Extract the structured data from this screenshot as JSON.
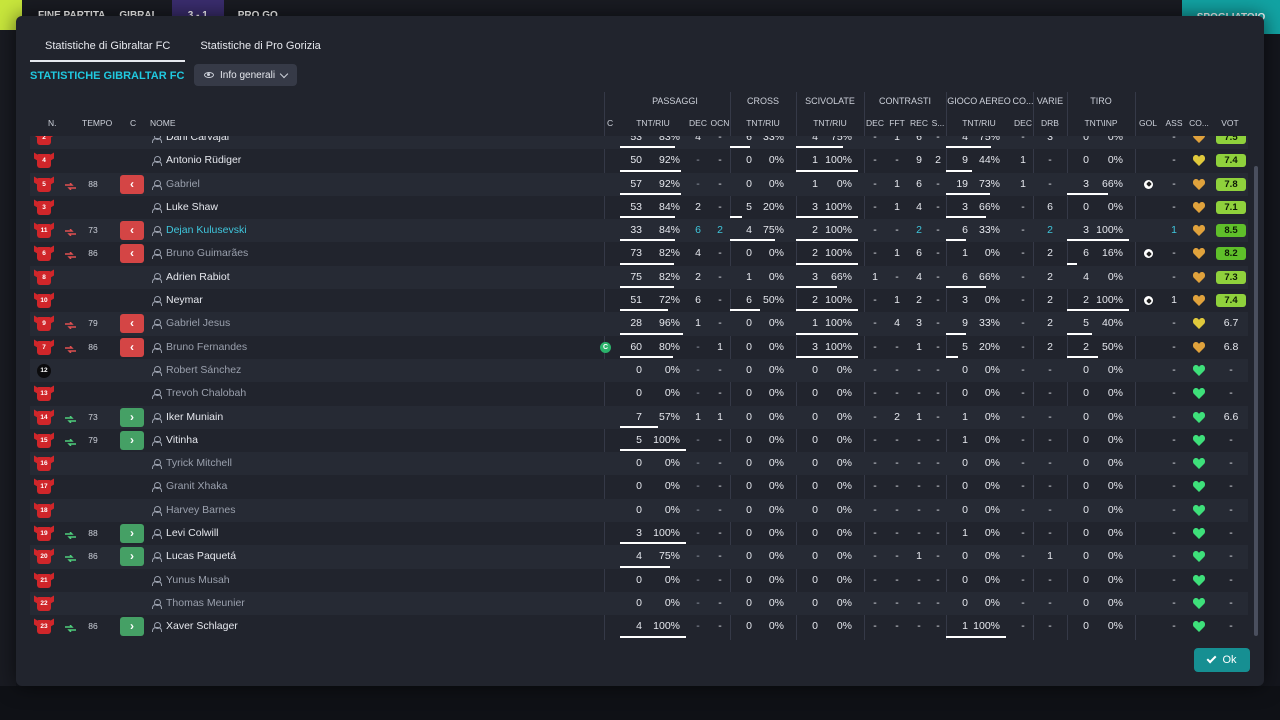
{
  "background": {
    "status": "FINE PARTITA",
    "home_short": "GIBRAL",
    "score": "3 - 1",
    "away_short": "PRO GO",
    "right_button": "SPOGLIATOIO"
  },
  "tabs": [
    {
      "label": "Statistiche di Gibraltar FC",
      "active": true
    },
    {
      "label": "Statistiche di Pro Gorizia",
      "active": false
    }
  ],
  "section_title": "STATISTICHE GIBRALTAR FC",
  "view_select": "Info generali",
  "groups": {
    "passaggi": "PASSAGGI",
    "cross": "CROSS",
    "scivolate": "SCIVOLATE",
    "contrasti": "CONTRASTI",
    "gioco_aereo": "GIOCO AEREO",
    "co": "CO...",
    "varie": "VARIE",
    "tiro": "TIRO"
  },
  "columns": {
    "n": "N.",
    "tempo": "TEMPO",
    "c": "C",
    "nome": "NOME",
    "c2": "C",
    "tnt_riu": "TNT/RIU",
    "dec": "DEC",
    "ocn": "OCN",
    "cross_tnt": "TNT/RIU",
    "sciv_tnt": "TNT/RIU",
    "contr_dec": "DEC",
    "fft": "FFT",
    "rec": "REC",
    "s": "S...",
    "aereo_tnt": "TNT/RIU",
    "co_dec": "DEC",
    "drb": "DRB",
    "tiro_tnt": "TNT\\INP",
    "gol": "GOL",
    "ass": "ASS",
    "co_col": "CO...",
    "vot": "VOT"
  },
  "players": [
    {
      "num": "2",
      "sub": "",
      "min": "",
      "btn": "",
      "name": "Dani Carvajal",
      "style": "",
      "capt": false,
      "pt": "53",
      "pp": "83%",
      "pbar": 0.83,
      "pdec": "4",
      "pocn": "-",
      "ct": "6",
      "cp": "33%",
      "cbar": 0.33,
      "st": "4",
      "sp": "75%",
      "sbar": 0.75,
      "tdec": "-",
      "fft": "1",
      "rec": "6",
      "s": "-",
      "at": "4",
      "ap": "75%",
      "abar": 0.75,
      "codec": "-",
      "drb": "3",
      "tt": "0",
      "tp": "0%",
      "tbar": 0,
      "gol": "",
      "ass": "-",
      "heart": "#e0a23c",
      "vot": "7.5",
      "votbg": "#8fd13c"
    },
    {
      "num": "4",
      "sub": "",
      "min": "",
      "btn": "",
      "name": "Antonio Rüdiger",
      "style": "",
      "capt": false,
      "pt": "50",
      "pp": "92%",
      "pbar": 0.92,
      "pdec": "-",
      "pocn": "-",
      "ct": "0",
      "cp": "0%",
      "cbar": 0,
      "st": "1",
      "sp": "100%",
      "sbar": 1,
      "tdec": "-",
      "fft": "-",
      "rec": "9",
      "s": "2",
      "at": "9",
      "ap": "44%",
      "abar": 0.44,
      "codec": "1",
      "drb": "-",
      "tt": "0",
      "tp": "0%",
      "tbar": 0,
      "gol": "",
      "ass": "-",
      "heart": "#e0c93c",
      "vot": "7.4",
      "votbg": "#8fd13c"
    },
    {
      "num": "5",
      "sub": "out",
      "min": "88",
      "btn": "out",
      "name": "Gabriel",
      "style": "dim",
      "capt": false,
      "pt": "57",
      "pp": "92%",
      "pbar": 0.92,
      "pdec": "-",
      "pocn": "-",
      "ct": "0",
      "cp": "0%",
      "cbar": 0,
      "st": "1",
      "sp": "0%",
      "sbar": 0,
      "tdec": "-",
      "fft": "1",
      "rec": "6",
      "s": "-",
      "at": "19",
      "ap": "73%",
      "abar": 0.73,
      "codec": "1",
      "drb": "-",
      "tt": "3",
      "tp": "66%",
      "tbar": 0.66,
      "gol": "ball",
      "ass": "-",
      "heart": "#e0a23c",
      "vot": "7.8",
      "votbg": "#8fd13c"
    },
    {
      "num": "3",
      "sub": "",
      "min": "",
      "btn": "",
      "name": "Luke Shaw",
      "style": "",
      "capt": false,
      "pt": "53",
      "pp": "84%",
      "pbar": 0.84,
      "pdec": "2",
      "pocn": "-",
      "ct": "5",
      "cp": "20%",
      "cbar": 0.2,
      "st": "3",
      "sp": "100%",
      "sbar": 1,
      "tdec": "-",
      "fft": "1",
      "rec": "4",
      "s": "-",
      "at": "3",
      "ap": "66%",
      "abar": 0.66,
      "codec": "-",
      "drb": "6",
      "tt": "0",
      "tp": "0%",
      "tbar": 0,
      "gol": "",
      "ass": "-",
      "heart": "#e0a23c",
      "vot": "7.1",
      "votbg": "#8fd13c"
    },
    {
      "num": "11",
      "sub": "out",
      "min": "73",
      "btn": "out",
      "name": "Dejan Kulusevski",
      "style": "hl",
      "capt": false,
      "pt": "33",
      "pp": "84%",
      "pbar": 0.84,
      "pdec": "6",
      "pocn": "2",
      "ct": "4",
      "cp": "75%",
      "cbar": 0.75,
      "st": "2",
      "sp": "100%",
      "sbar": 1,
      "tdec": "-",
      "fft": "-",
      "rec": "2",
      "s": "-",
      "at": "6",
      "ap": "33%",
      "abar": 0.33,
      "codec": "-",
      "drb": "2",
      "tt": "3",
      "tp": "100%",
      "tbar": 1,
      "gol": "",
      "ass": "1",
      "heart": "#e0a23c",
      "vot": "8.5",
      "votbg": "#5fbf2a"
    },
    {
      "num": "6",
      "sub": "out",
      "min": "86",
      "btn": "out",
      "name": "Bruno Guimarães",
      "style": "dim",
      "capt": false,
      "pt": "73",
      "pp": "82%",
      "pbar": 0.82,
      "pdec": "4",
      "pocn": "-",
      "ct": "0",
      "cp": "0%",
      "cbar": 0,
      "st": "2",
      "sp": "100%",
      "sbar": 1,
      "tdec": "-",
      "fft": "1",
      "rec": "6",
      "s": "-",
      "at": "1",
      "ap": "0%",
      "abar": 0,
      "codec": "-",
      "drb": "2",
      "tt": "6",
      "tp": "16%",
      "tbar": 0.16,
      "gol": "ball",
      "ass": "-",
      "heart": "#e0a23c",
      "vot": "8.2",
      "votbg": "#5fbf2a"
    },
    {
      "num": "8",
      "sub": "",
      "min": "",
      "btn": "",
      "name": "Adrien Rabiot",
      "style": "",
      "capt": false,
      "pt": "75",
      "pp": "82%",
      "pbar": 0.82,
      "pdec": "2",
      "pocn": "-",
      "ct": "1",
      "cp": "0%",
      "cbar": 0,
      "st": "3",
      "sp": "66%",
      "sbar": 0.66,
      "tdec": "1",
      "fft": "-",
      "rec": "4",
      "s": "-",
      "at": "6",
      "ap": "66%",
      "abar": 0.66,
      "codec": "-",
      "drb": "2",
      "tt": "4",
      "tp": "0%",
      "tbar": 0,
      "gol": "",
      "ass": "-",
      "heart": "#e0a23c",
      "vot": "7.3",
      "votbg": "#8fd13c"
    },
    {
      "num": "10",
      "sub": "",
      "min": "",
      "btn": "",
      "name": "Neymar",
      "style": "",
      "capt": false,
      "pt": "51",
      "pp": "72%",
      "pbar": 0.72,
      "pdec": "6",
      "pocn": "-",
      "ct": "6",
      "cp": "50%",
      "cbar": 0.5,
      "st": "2",
      "sp": "100%",
      "sbar": 1,
      "tdec": "-",
      "fft": "1",
      "rec": "2",
      "s": "-",
      "at": "3",
      "ap": "0%",
      "abar": 0,
      "codec": "-",
      "drb": "2",
      "tt": "2",
      "tp": "100%",
      "tbar": 1,
      "gol": "ball",
      "ass": "1",
      "heart": "#e0a23c",
      "vot": "7.4",
      "votbg": "#8fd13c"
    },
    {
      "num": "9",
      "sub": "out",
      "min": "79",
      "btn": "out",
      "name": "Gabriel Jesus",
      "style": "dim",
      "capt": false,
      "pt": "28",
      "pp": "96%",
      "pbar": 0.96,
      "pdec": "1",
      "pocn": "-",
      "ct": "0",
      "cp": "0%",
      "cbar": 0,
      "st": "1",
      "sp": "100%",
      "sbar": 1,
      "tdec": "-",
      "fft": "4",
      "rec": "3",
      "s": "-",
      "at": "9",
      "ap": "33%",
      "abar": 0.33,
      "codec": "-",
      "drb": "2",
      "tt": "5",
      "tp": "40%",
      "tbar": 0.4,
      "gol": "",
      "ass": "-",
      "heart": "#e0c93c",
      "vot": "6.7",
      "votbg": ""
    },
    {
      "num": "7",
      "sub": "out",
      "min": "86",
      "btn": "out",
      "name": "Bruno Fernandes",
      "style": "dim",
      "capt": true,
      "pt": "60",
      "pp": "80%",
      "pbar": 0.8,
      "pdec": "-",
      "pocn": "1",
      "ct": "0",
      "cp": "0%",
      "cbar": 0,
      "st": "3",
      "sp": "100%",
      "sbar": 1,
      "tdec": "-",
      "fft": "-",
      "rec": "1",
      "s": "-",
      "at": "5",
      "ap": "20%",
      "abar": 0.2,
      "codec": "-",
      "drb": "2",
      "tt": "2",
      "tp": "50%",
      "tbar": 0.5,
      "gol": "",
      "ass": "-",
      "heart": "#e0a23c",
      "vot": "6.8",
      "votbg": ""
    },
    {
      "num": "12",
      "gk": true,
      "sub": "",
      "min": "",
      "btn": "",
      "name": "Robert Sánchez",
      "style": "dim",
      "capt": false,
      "pt": "0",
      "pp": "0%",
      "pbar": 0,
      "pdec": "-",
      "pocn": "-",
      "ct": "0",
      "cp": "0%",
      "cbar": 0,
      "st": "0",
      "sp": "0%",
      "sbar": 0,
      "tdec": "-",
      "fft": "-",
      "rec": "-",
      "s": "-",
      "at": "0",
      "ap": "0%",
      "abar": 0,
      "codec": "-",
      "drb": "-",
      "tt": "0",
      "tp": "0%",
      "tbar": 0,
      "gol": "",
      "ass": "-",
      "heart": "#3ee07a",
      "vot": "-",
      "votbg": ""
    },
    {
      "num": "13",
      "sub": "",
      "min": "",
      "btn": "",
      "name": "Trevoh Chalobah",
      "style": "dim",
      "capt": false,
      "pt": "0",
      "pp": "0%",
      "pbar": 0,
      "pdec": "-",
      "pocn": "-",
      "ct": "0",
      "cp": "0%",
      "cbar": 0,
      "st": "0",
      "sp": "0%",
      "sbar": 0,
      "tdec": "-",
      "fft": "-",
      "rec": "-",
      "s": "-",
      "at": "0",
      "ap": "0%",
      "abar": 0,
      "codec": "-",
      "drb": "-",
      "tt": "0",
      "tp": "0%",
      "tbar": 0,
      "gol": "",
      "ass": "-",
      "heart": "#3ee07a",
      "vot": "-",
      "votbg": ""
    },
    {
      "num": "14",
      "sub": "in",
      "min": "73",
      "btn": "in",
      "name": "Iker Muniain",
      "style": "",
      "capt": false,
      "pt": "7",
      "pp": "57%",
      "pbar": 0.57,
      "pdec": "1",
      "pocn": "1",
      "ct": "0",
      "cp": "0%",
      "cbar": 0,
      "st": "0",
      "sp": "0%",
      "sbar": 0,
      "tdec": "-",
      "fft": "2",
      "rec": "1",
      "s": "-",
      "at": "1",
      "ap": "0%",
      "abar": 0,
      "codec": "-",
      "drb": "-",
      "tt": "0",
      "tp": "0%",
      "tbar": 0,
      "gol": "",
      "ass": "-",
      "heart": "#3ee07a",
      "vot": "6.6",
      "votbg": ""
    },
    {
      "num": "15",
      "sub": "in",
      "min": "79",
      "btn": "in",
      "name": "Vitinha",
      "style": "",
      "capt": false,
      "pt": "5",
      "pp": "100%",
      "pbar": 1,
      "pdec": "-",
      "pocn": "-",
      "ct": "0",
      "cp": "0%",
      "cbar": 0,
      "st": "0",
      "sp": "0%",
      "sbar": 0,
      "tdec": "-",
      "fft": "-",
      "rec": "-",
      "s": "-",
      "at": "1",
      "ap": "0%",
      "abar": 0,
      "codec": "-",
      "drb": "-",
      "tt": "0",
      "tp": "0%",
      "tbar": 0,
      "gol": "",
      "ass": "-",
      "heart": "#3ee07a",
      "vot": "-",
      "votbg": ""
    },
    {
      "num": "16",
      "sub": "",
      "min": "",
      "btn": "",
      "name": "Tyrick Mitchell",
      "style": "dim",
      "capt": false,
      "pt": "0",
      "pp": "0%",
      "pbar": 0,
      "pdec": "-",
      "pocn": "-",
      "ct": "0",
      "cp": "0%",
      "cbar": 0,
      "st": "0",
      "sp": "0%",
      "sbar": 0,
      "tdec": "-",
      "fft": "-",
      "rec": "-",
      "s": "-",
      "at": "0",
      "ap": "0%",
      "abar": 0,
      "codec": "-",
      "drb": "-",
      "tt": "0",
      "tp": "0%",
      "tbar": 0,
      "gol": "",
      "ass": "-",
      "heart": "#3ee07a",
      "vot": "-",
      "votbg": ""
    },
    {
      "num": "17",
      "sub": "",
      "min": "",
      "btn": "",
      "name": "Granit Xhaka",
      "style": "dim",
      "capt": false,
      "pt": "0",
      "pp": "0%",
      "pbar": 0,
      "pdec": "-",
      "pocn": "-",
      "ct": "0",
      "cp": "0%",
      "cbar": 0,
      "st": "0",
      "sp": "0%",
      "sbar": 0,
      "tdec": "-",
      "fft": "-",
      "rec": "-",
      "s": "-",
      "at": "0",
      "ap": "0%",
      "abar": 0,
      "codec": "-",
      "drb": "-",
      "tt": "0",
      "tp": "0%",
      "tbar": 0,
      "gol": "",
      "ass": "-",
      "heart": "#3ee07a",
      "vot": "-",
      "votbg": ""
    },
    {
      "num": "18",
      "sub": "",
      "min": "",
      "btn": "",
      "name": "Harvey Barnes",
      "style": "dim",
      "capt": false,
      "pt": "0",
      "pp": "0%",
      "pbar": 0,
      "pdec": "-",
      "pocn": "-",
      "ct": "0",
      "cp": "0%",
      "cbar": 0,
      "st": "0",
      "sp": "0%",
      "sbar": 0,
      "tdec": "-",
      "fft": "-",
      "rec": "-",
      "s": "-",
      "at": "0",
      "ap": "0%",
      "abar": 0,
      "codec": "-",
      "drb": "-",
      "tt": "0",
      "tp": "0%",
      "tbar": 0,
      "gol": "",
      "ass": "-",
      "heart": "#3ee07a",
      "vot": "-",
      "votbg": ""
    },
    {
      "num": "19",
      "sub": "in",
      "min": "88",
      "btn": "in",
      "name": "Levi Colwill",
      "style": "",
      "capt": false,
      "pt": "3",
      "pp": "100%",
      "pbar": 1,
      "pdec": "-",
      "pocn": "-",
      "ct": "0",
      "cp": "0%",
      "cbar": 0,
      "st": "0",
      "sp": "0%",
      "sbar": 0,
      "tdec": "-",
      "fft": "-",
      "rec": "-",
      "s": "-",
      "at": "1",
      "ap": "0%",
      "abar": 0,
      "codec": "-",
      "drb": "-",
      "tt": "0",
      "tp": "0%",
      "tbar": 0,
      "gol": "",
      "ass": "-",
      "heart": "#3ee07a",
      "vot": "-",
      "votbg": ""
    },
    {
      "num": "20",
      "sub": "in",
      "min": "86",
      "btn": "in",
      "name": "Lucas Paquetá",
      "style": "",
      "capt": false,
      "pt": "4",
      "pp": "75%",
      "pbar": 0.75,
      "pdec": "-",
      "pocn": "-",
      "ct": "0",
      "cp": "0%",
      "cbar": 0,
      "st": "0",
      "sp": "0%",
      "sbar": 0,
      "tdec": "-",
      "fft": "-",
      "rec": "1",
      "s": "-",
      "at": "0",
      "ap": "0%",
      "abar": 0,
      "codec": "-",
      "drb": "1",
      "tt": "0",
      "tp": "0%",
      "tbar": 0,
      "gol": "",
      "ass": "-",
      "heart": "#3ee07a",
      "vot": "-",
      "votbg": ""
    },
    {
      "num": "21",
      "sub": "",
      "min": "",
      "btn": "",
      "name": "Yunus Musah",
      "style": "dim",
      "capt": false,
      "pt": "0",
      "pp": "0%",
      "pbar": 0,
      "pdec": "-",
      "pocn": "-",
      "ct": "0",
      "cp": "0%",
      "cbar": 0,
      "st": "0",
      "sp": "0%",
      "sbar": 0,
      "tdec": "-",
      "fft": "-",
      "rec": "-",
      "s": "-",
      "at": "0",
      "ap": "0%",
      "abar": 0,
      "codec": "-",
      "drb": "-",
      "tt": "0",
      "tp": "0%",
      "tbar": 0,
      "gol": "",
      "ass": "-",
      "heart": "#3ee07a",
      "vot": "-",
      "votbg": ""
    },
    {
      "num": "22",
      "sub": "",
      "min": "",
      "btn": "",
      "name": "Thomas Meunier",
      "style": "dim",
      "capt": false,
      "pt": "0",
      "pp": "0%",
      "pbar": 0,
      "pdec": "-",
      "pocn": "-",
      "ct": "0",
      "cp": "0%",
      "cbar": 0,
      "st": "0",
      "sp": "0%",
      "sbar": 0,
      "tdec": "-",
      "fft": "-",
      "rec": "-",
      "s": "-",
      "at": "0",
      "ap": "0%",
      "abar": 0,
      "codec": "-",
      "drb": "-",
      "tt": "0",
      "tp": "0%",
      "tbar": 0,
      "gol": "",
      "ass": "-",
      "heart": "#3ee07a",
      "vot": "-",
      "votbg": ""
    },
    {
      "num": "23",
      "sub": "in",
      "min": "86",
      "btn": "in",
      "name": "Xaver Schlager",
      "style": "",
      "capt": false,
      "pt": "4",
      "pp": "100%",
      "pbar": 1,
      "pdec": "-",
      "pocn": "-",
      "ct": "0",
      "cp": "0%",
      "cbar": 0,
      "st": "0",
      "sp": "0%",
      "sbar": 0,
      "tdec": "-",
      "fft": "-",
      "rec": "-",
      "s": "-",
      "at": "1",
      "ap": "100%",
      "abar": 1,
      "codec": "-",
      "drb": "-",
      "tt": "0",
      "tp": "0%",
      "tbar": 0,
      "gol": "",
      "ass": "-",
      "heart": "#3ee07a",
      "vot": "-",
      "votbg": ""
    }
  ],
  "ok_label": "Ok"
}
